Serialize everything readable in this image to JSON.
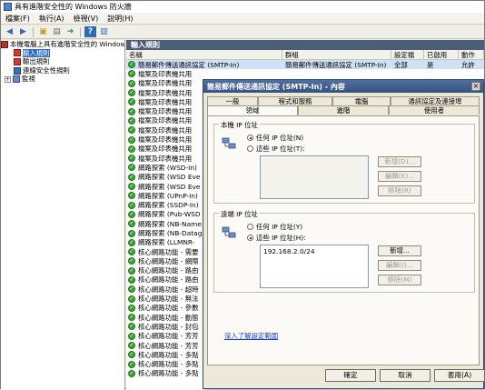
{
  "window": {
    "title": "具有進階安全性的 Windows 防火牆"
  },
  "menu": [
    "檔案(F)",
    "執行(A)",
    "檢視(V)",
    "說明(H)"
  ],
  "toolbar": [
    {
      "icon": "back-arrow-icon",
      "glyph": "◀"
    },
    {
      "icon": "forward-arrow-icon",
      "glyph": "▶"
    },
    {
      "icon": "folder-up-icon",
      "glyph": "▣"
    },
    {
      "icon": "properties-icon",
      "glyph": "▤"
    },
    {
      "icon": "export-icon",
      "glyph": "➜"
    },
    {
      "icon": "help-icon",
      "glyph": "?"
    },
    {
      "icon": "panel-icon",
      "glyph": "▥"
    }
  ],
  "tree": {
    "root": "本機電腦上具有進階安全性的 Windows 防火牆",
    "items": [
      {
        "label": "輸入規則",
        "selected": true
      },
      {
        "label": "輸出規則",
        "selected": false
      },
      {
        "label": "連線安全性規則",
        "selected": false
      },
      {
        "label": "監視",
        "selected": false,
        "expandable": true,
        "expander": "+"
      }
    ]
  },
  "rules": {
    "pane_title": "輸入規則",
    "columns": [
      "名稱",
      "群組",
      "設定檔",
      "已啟用",
      "動作"
    ],
    "rows": [
      [
        "簡易郵件傳送通訊協定 (SMTP-In)",
        "簡易郵件傳送通訊協定 (SMTP-In)",
        "全部",
        "是",
        "允許"
      ],
      [
        "檔案及印表機共用",
        "",
        "",
        "",
        ""
      ],
      [
        "檔案及印表機共用",
        "",
        "",
        "",
        ""
      ],
      [
        "檔案及印表機共用",
        "",
        "",
        "",
        ""
      ],
      [
        "檔案及印表機共用",
        "",
        "",
        "",
        ""
      ],
      [
        "檔案及印表機共用",
        "",
        "",
        "",
        ""
      ],
      [
        "檔案及印表機共用",
        "",
        "",
        "",
        ""
      ],
      [
        "檔案及印表機共用",
        "",
        "",
        "",
        ""
      ],
      [
        "檔案及印表機共用",
        "",
        "",
        "",
        ""
      ],
      [
        "檔案及印表機共用",
        "",
        "",
        "",
        ""
      ],
      [
        "檔案及印表機共用",
        "",
        "",
        "",
        ""
      ],
      [
        "網路探索 (WSD-In)",
        "",
        "",
        "",
        ""
      ],
      [
        "網路探索 (WSD Eve",
        "",
        "",
        "",
        ""
      ],
      [
        "網路探索 (WSD Eve",
        "",
        "",
        "",
        ""
      ],
      [
        "網路探索 (UPnP-In)",
        "",
        "",
        "",
        ""
      ],
      [
        "網路探索 (SSDP-In)",
        "",
        "",
        "",
        ""
      ],
      [
        "網路探索 (Pub-WSD",
        "",
        "",
        "",
        ""
      ],
      [
        "網路探索 (NB-Name",
        "",
        "",
        "",
        ""
      ],
      [
        "網路探索 (NB-Datag",
        "",
        "",
        "",
        ""
      ],
      [
        "網路探索 (LLMNR-",
        "",
        "",
        "",
        ""
      ],
      [
        "核心網路功能 - 需要",
        "",
        "",
        "",
        ""
      ],
      [
        "核心網路功能 - 網際",
        "",
        "",
        "",
        ""
      ],
      [
        "核心網路功能 - 路由",
        "",
        "",
        "",
        ""
      ],
      [
        "核心網路功能 - 路由",
        "",
        "",
        "",
        ""
      ],
      [
        "核心網路功能 - 超時",
        "",
        "",
        "",
        ""
      ],
      [
        "核心網路功能 - 無法",
        "",
        "",
        "",
        ""
      ],
      [
        "核心網路功能 - 參數",
        "",
        "",
        "",
        ""
      ],
      [
        "核心網路功能 - 動態",
        "",
        "",
        "",
        ""
      ],
      [
        "核心網路功能 - 封包",
        "",
        "",
        "",
        ""
      ],
      [
        "核心網路功能 - 芳芳",
        "",
        "",
        "",
        ""
      ],
      [
        "核心網路功能 - 芳芳",
        "",
        "",
        "",
        ""
      ],
      [
        "核心網路功能 - 多點",
        "",
        "",
        "",
        ""
      ],
      [
        "核心網路功能 - 多點",
        "",
        "",
        "",
        ""
      ],
      [
        "核心網路功能 - 多點",
        "",
        "",
        "",
        ""
      ]
    ]
  },
  "dialog": {
    "title": "簡易郵件傳送通訊協定 (SMTP-In) - 內容",
    "close_glyph": "×",
    "tabs_back": [
      "一般",
      "程式和服務",
      "電腦",
      "通訊協定及連接埠"
    ],
    "tabs_front": [
      "領域",
      "進階",
      "使用者"
    ],
    "active_tab": "領域",
    "local": {
      "title": "本機 IP 位址",
      "radio_any": "任何 IP 位址(N)",
      "radio_these": "這些 IP 位址(T):",
      "selected": "any",
      "buttons": [
        "新增(D)...",
        "編輯(E)...",
        "移除(R)"
      ]
    },
    "remote": {
      "title": "遠端 IP 位址",
      "radio_any": "任何 IP 位址(Y)",
      "radio_these": "這些 IP 位址(H):",
      "selected": "these",
      "addresses": [
        "192.168.2.0/24"
      ],
      "buttons": [
        "新增...",
        "編輯(I)...",
        "移除(M)"
      ]
    },
    "link": "深入了解設定範圍",
    "footer": [
      "確定",
      "取消",
      "套用(A)"
    ]
  }
}
